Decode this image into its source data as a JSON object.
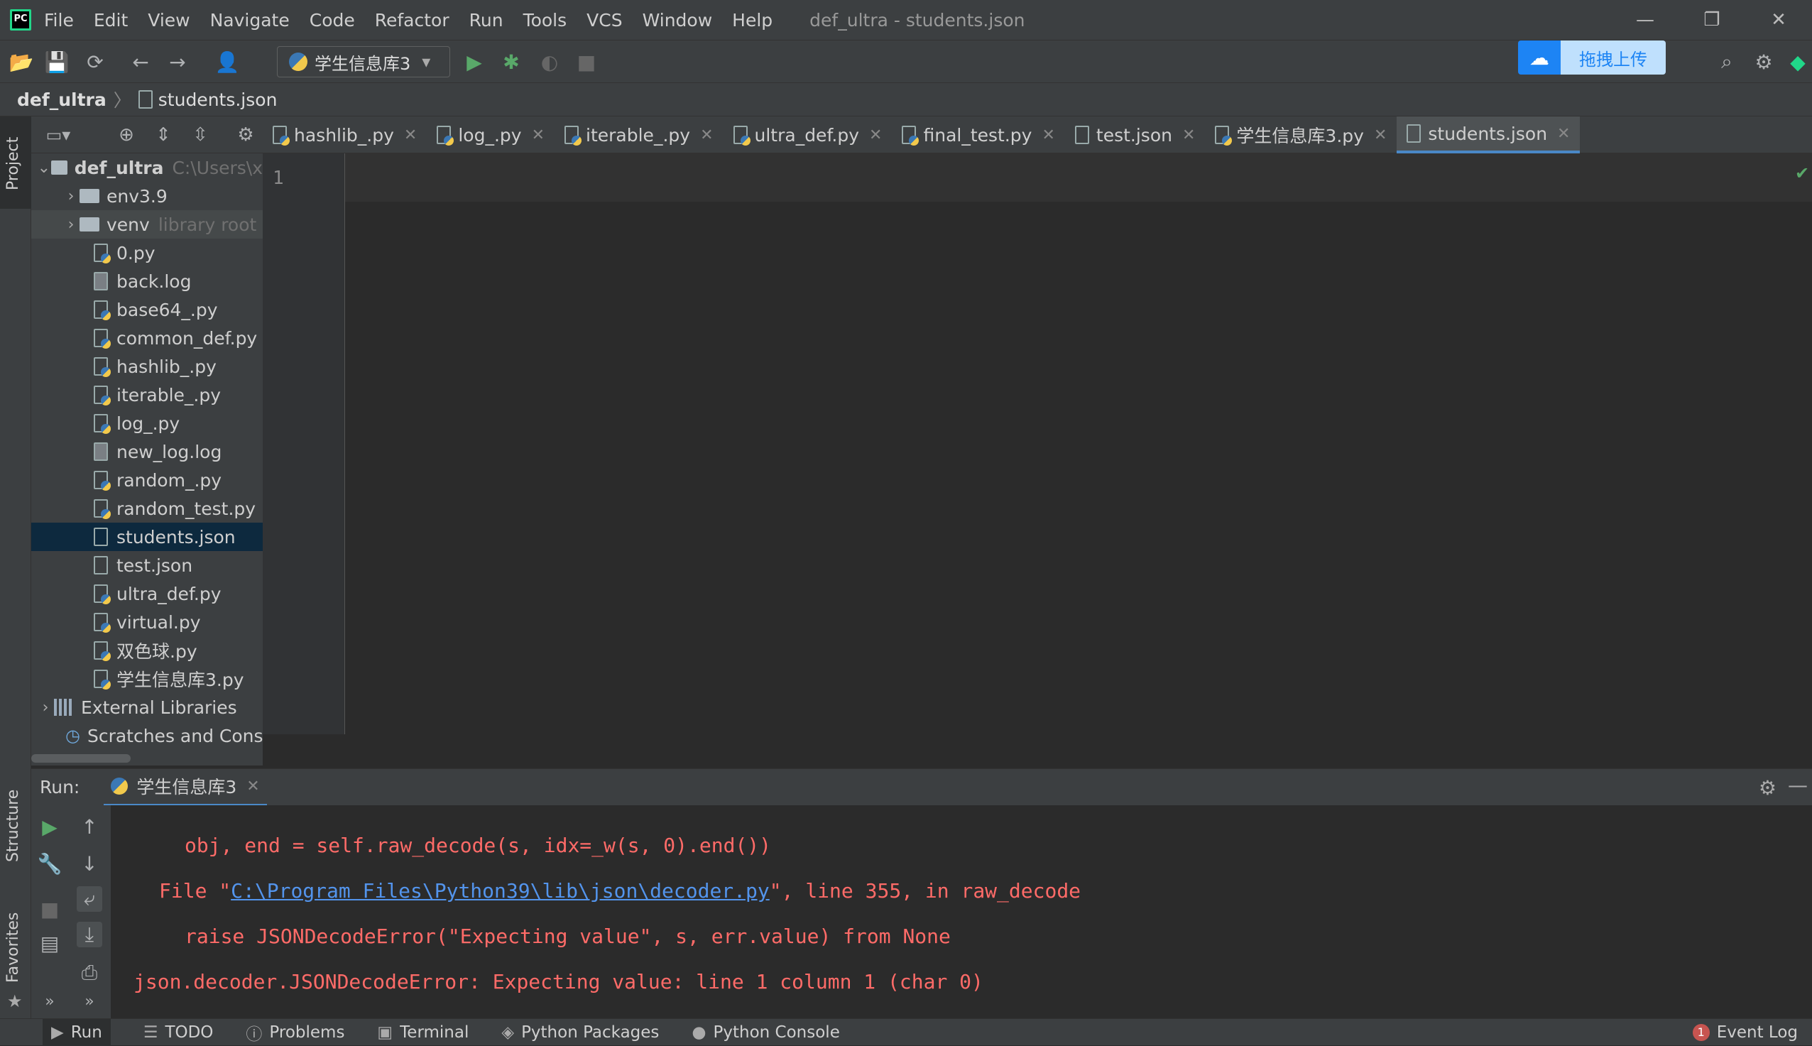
{
  "app": {
    "window_title": "def_ultra - students.json",
    "logo_text": "PC"
  },
  "menu": [
    "File",
    "Edit",
    "View",
    "Navigate",
    "Code",
    "Refactor",
    "Run",
    "Tools",
    "VCS",
    "Window",
    "Help"
  ],
  "toolbar": {
    "run_config": "学生信息库3",
    "upload_label": "拖拽上传"
  },
  "breadcrumb": {
    "project": "def_ultra",
    "file": "students.json"
  },
  "side_stripe": {
    "project": "Project",
    "structure": "Structure",
    "favorites": "Favorites"
  },
  "project_tree": {
    "root": {
      "name": "def_ultra",
      "path": "C:\\Users\\x"
    },
    "folders": [
      {
        "name": "env3.9",
        "hint": ""
      },
      {
        "name": "venv",
        "hint": "library root"
      }
    ],
    "files": [
      {
        "name": "0.py",
        "type": "py"
      },
      {
        "name": "back.log",
        "type": "log"
      },
      {
        "name": "base64_.py",
        "type": "py"
      },
      {
        "name": "common_def.py",
        "type": "py"
      },
      {
        "name": "hashlib_.py",
        "type": "py"
      },
      {
        "name": "iterable_.py",
        "type": "py"
      },
      {
        "name": "log_.py",
        "type": "py"
      },
      {
        "name": "new_log.log",
        "type": "log"
      },
      {
        "name": "random_.py",
        "type": "py"
      },
      {
        "name": "random_test.py",
        "type": "py"
      },
      {
        "name": "students.json",
        "type": "json"
      },
      {
        "name": "test.json",
        "type": "json"
      },
      {
        "name": "ultra_def.py",
        "type": "py"
      },
      {
        "name": "virtual.py",
        "type": "py"
      },
      {
        "name": "双色球.py",
        "type": "py"
      },
      {
        "name": "学生信息库3.py",
        "type": "py"
      }
    ],
    "external_libraries": "External Libraries",
    "scratches": "Scratches and Conso"
  },
  "tabs": [
    {
      "label": "hashlib_.py",
      "type": "py"
    },
    {
      "label": "log_.py",
      "type": "py"
    },
    {
      "label": "iterable_.py",
      "type": "py"
    },
    {
      "label": "ultra_def.py",
      "type": "py"
    },
    {
      "label": "final_test.py",
      "type": "py"
    },
    {
      "label": "test.json",
      "type": "json"
    },
    {
      "label": "学生信息库3.py",
      "type": "py"
    },
    {
      "label": "students.json",
      "type": "json",
      "active": true
    }
  ],
  "editor": {
    "line_number": "1"
  },
  "run_panel": {
    "label": "Run:",
    "config_tab": "学生信息库3"
  },
  "console": {
    "line1": "obj, end = self.raw_decode(s, idx=_w(s, 0).end())",
    "line2_prefix": "File \"",
    "line2_link": "C:\\Program Files\\Python39\\lib\\json\\decoder.py",
    "line2_suffix": "\", line 355, in raw_decode",
    "line3": "raise JSONDecodeError(\"Expecting value\", s, err.value) from None",
    "line4": "json.decoder.JSONDecodeError: Expecting value: line 1 column 1 (char 0)"
  },
  "statusbar": {
    "items": [
      "Run",
      "TODO",
      "Problems",
      "Terminal",
      "Python Packages",
      "Python Console"
    ],
    "event_log": "Event Log",
    "event_count": "1"
  },
  "colors": {
    "accent": "#4a88c7",
    "error": "#ff6b68",
    "link": "#5394ec"
  }
}
